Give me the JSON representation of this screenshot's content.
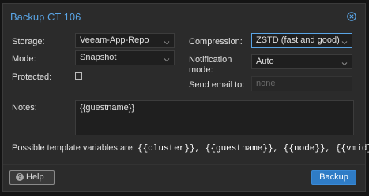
{
  "dialog": {
    "title": "Backup CT 106"
  },
  "left": {
    "storage_label": "Storage:",
    "storage_value": "Veeam-App-Repo",
    "mode_label": "Mode:",
    "mode_value": "Snapshot",
    "protected_label": "Protected:",
    "protected_checked": false
  },
  "right": {
    "compression_label": "Compression:",
    "compression_value": "ZSTD (fast and good)",
    "notification_label_line1": "Notification",
    "notification_label_line2": "mode:",
    "notification_value": "Auto",
    "email_label": "Send email to:",
    "email_placeholder": "none"
  },
  "notes": {
    "label": "Notes:",
    "value": "{{guestname}}"
  },
  "hint": {
    "prefix": "Possible template variables are: ",
    "vars": "{{cluster}}, {{guestname}}, {{node}}, {{vmid}}"
  },
  "footer": {
    "help_label": "Help",
    "backup_label": "Backup"
  },
  "colors": {
    "accent": "#5aa5e6",
    "primary_button": "#2f7cc6"
  }
}
